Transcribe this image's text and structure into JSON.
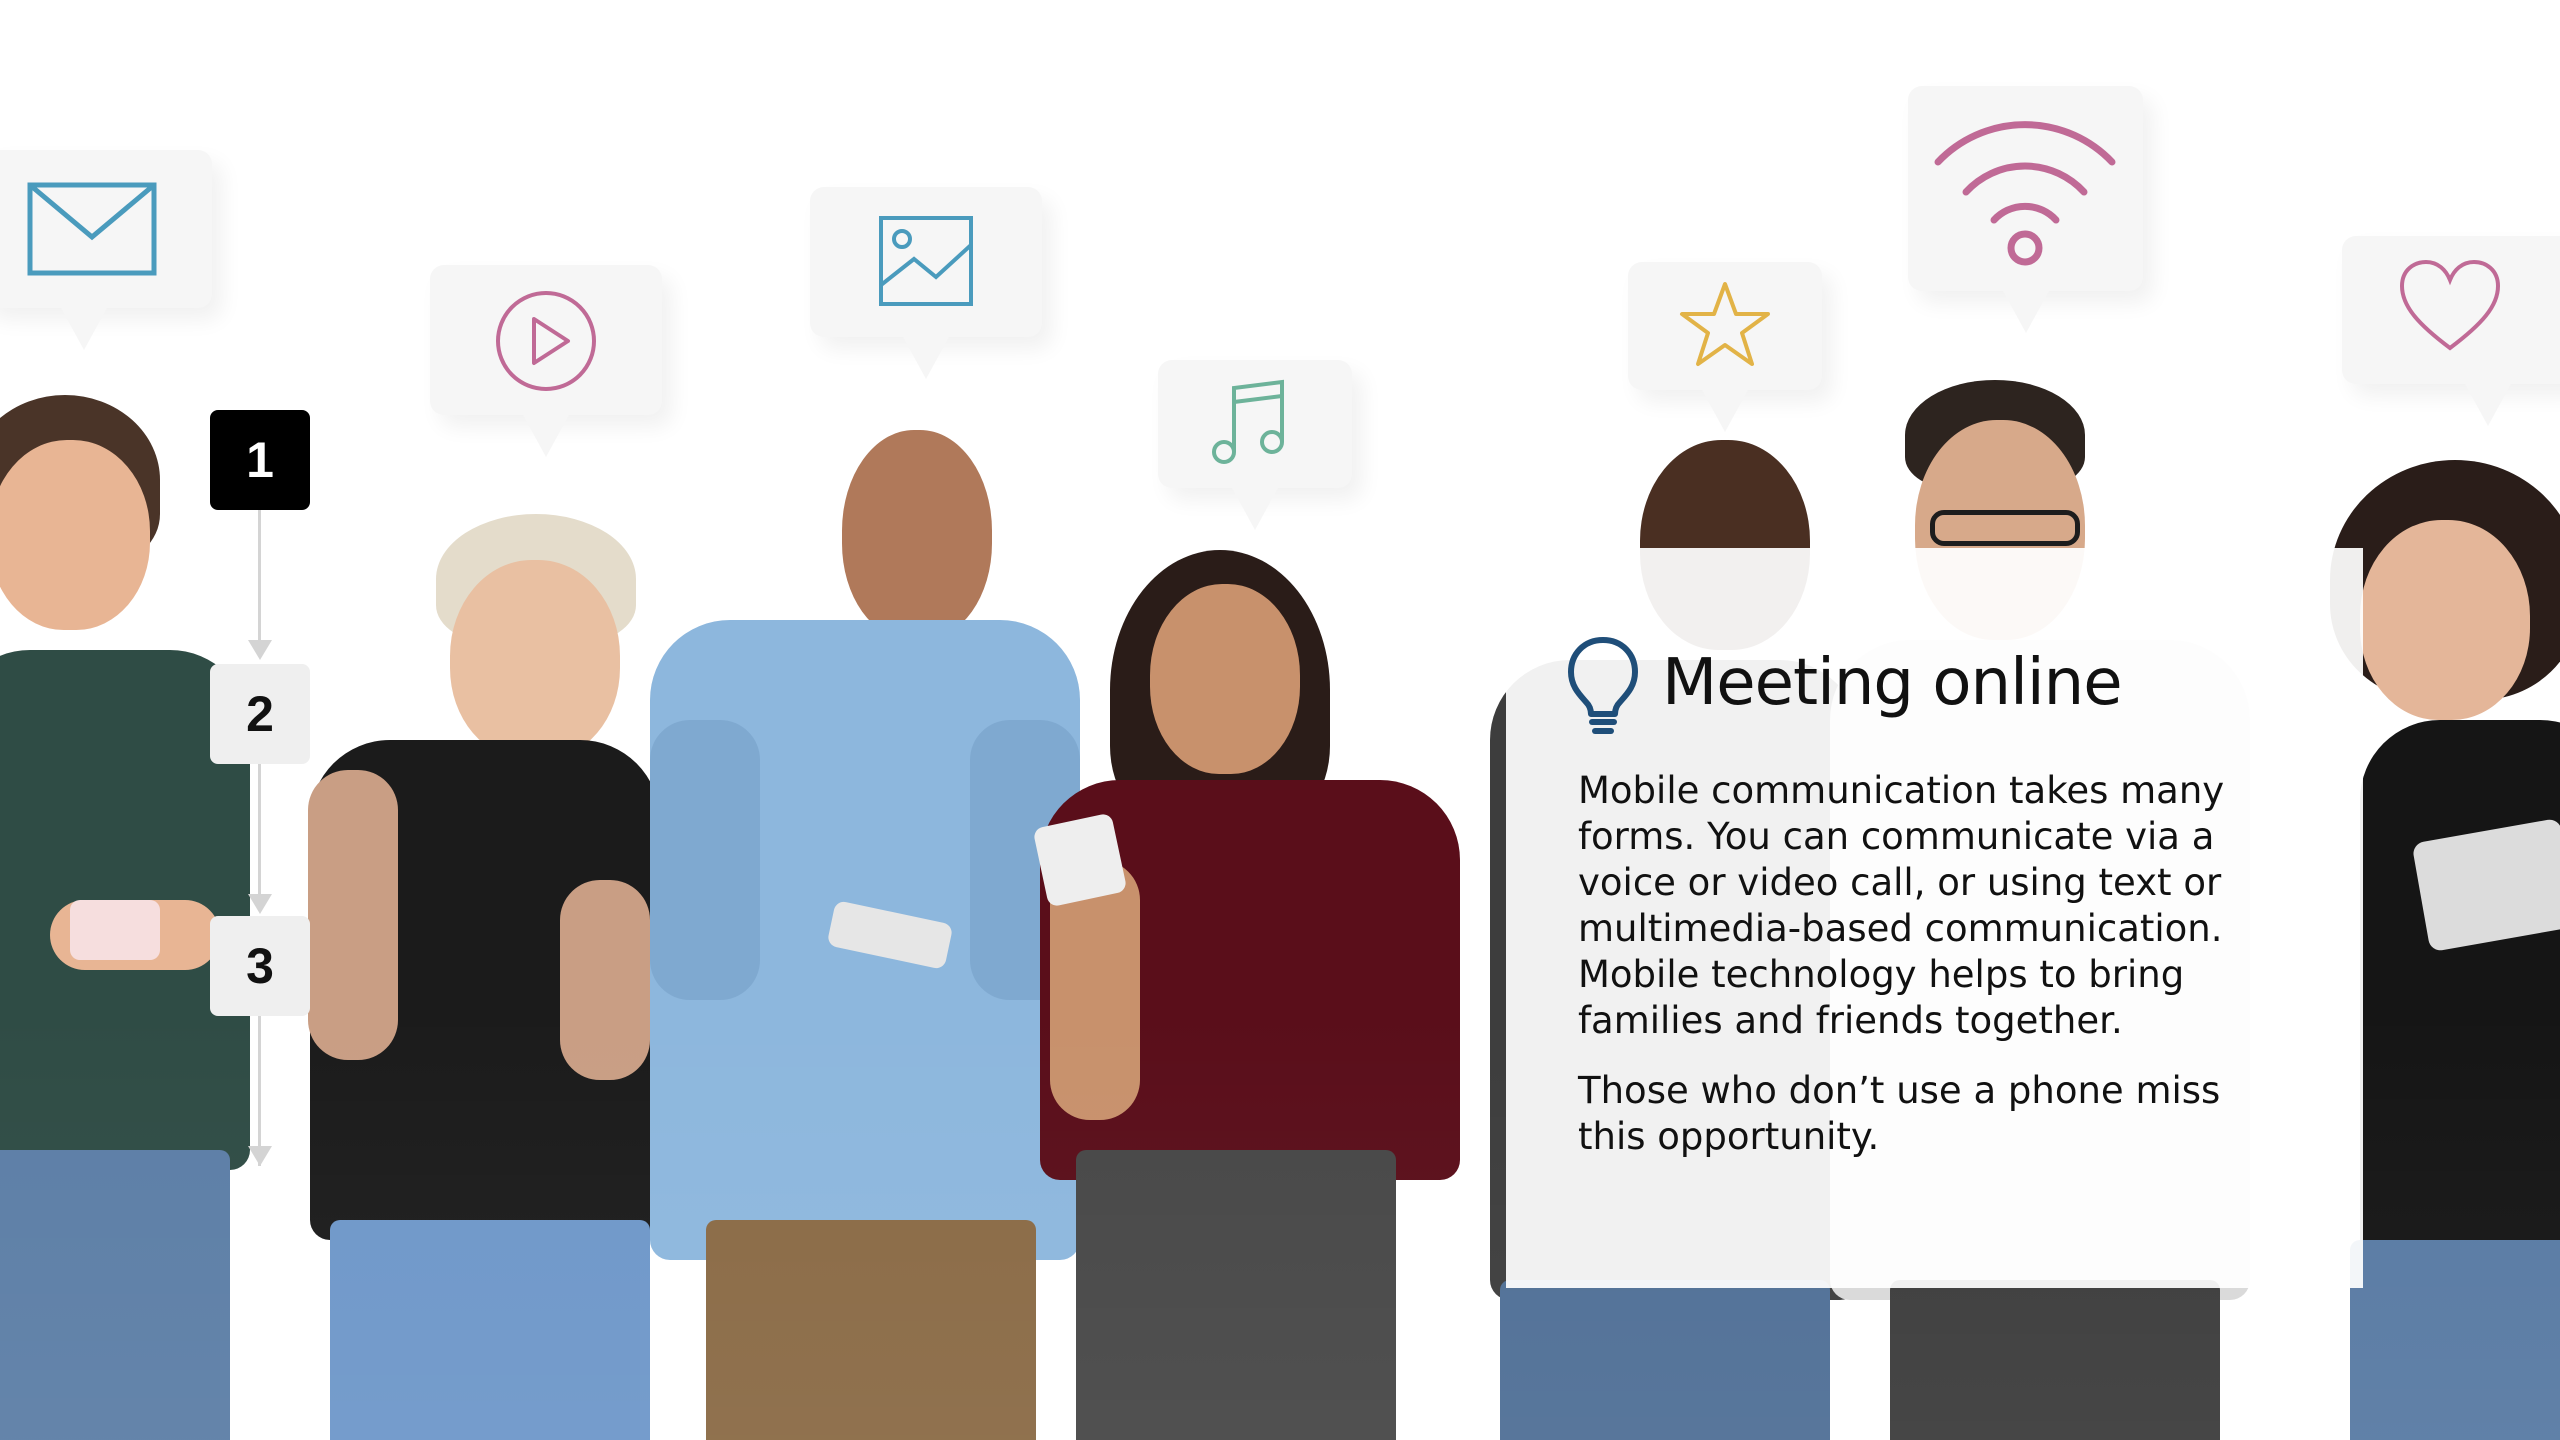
{
  "slide": {
    "steps": [
      {
        "label": "1",
        "state": "active"
      },
      {
        "label": "2",
        "state": "inactive"
      },
      {
        "label": "3",
        "state": "inactive"
      }
    ],
    "content": {
      "icon": "lightbulb-icon",
      "title": "Meeting online",
      "paragraphs": [
        "Mobile communication takes many forms. You can communicate via a voice or video call, or using text or multimedia-based communication. Mobile technology helps to bring families and friends together.",
        "Those who don’t use a phone miss this opportunity."
      ]
    },
    "background_icons": [
      "envelope-icon",
      "play-icon",
      "image-icon",
      "music-note-icon",
      "star-icon",
      "wifi-icon",
      "heart-icon"
    ]
  },
  "colors": {
    "accent_blue": "#1f4e79",
    "icon_blue": "#4a9bbd",
    "icon_pink": "#c06a96",
    "icon_green": "#6db39a",
    "icon_gold": "#e2b347",
    "step_active": "#000000",
    "step_inactive": "#efefef"
  }
}
